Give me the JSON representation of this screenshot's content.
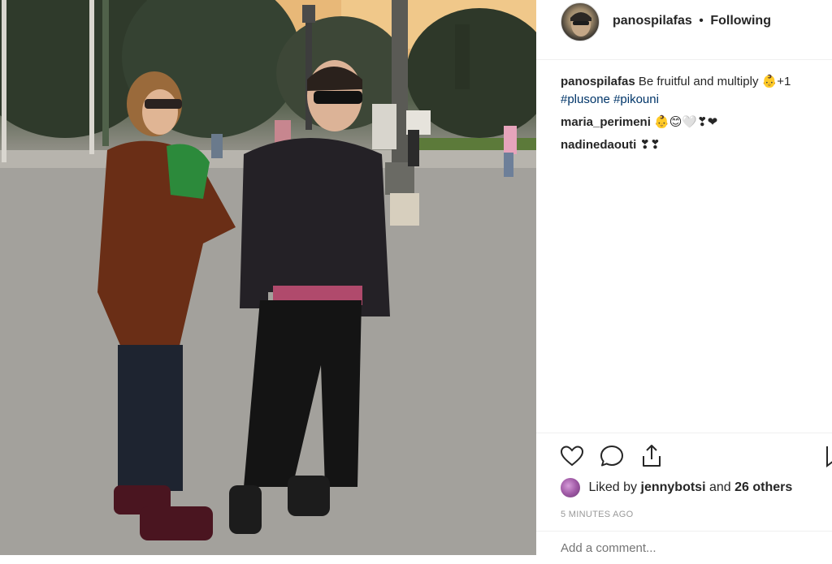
{
  "post": {
    "photo_icon": "photo-of-family-in-park",
    "header": {
      "username": "panospilafas",
      "separator": "•",
      "follow_state": "Following"
    },
    "comments": [
      {
        "user": "panospilafas",
        "text": "Be fruitful and multiply 👶+1",
        "hashtags": [
          "#plusone",
          "#pikouni"
        ]
      },
      {
        "user": "maria_perimeni",
        "text": "👶😊🤍❣❤"
      },
      {
        "user": "nadinedaouti",
        "text": "❣❣"
      }
    ],
    "actions": {
      "like_icon": "heart-icon",
      "comment_icon": "comment-bubble-icon",
      "share_icon": "share-icon",
      "save_icon": "bookmark-icon"
    },
    "likes": {
      "prefix": "Liked by",
      "user": "jennybotsi",
      "conjunction": "and",
      "others": "26 others"
    },
    "timestamp": "5 MINUTES AGO",
    "add_comment_placeholder": "Add a comment..."
  },
  "colors": {
    "text": "#262626",
    "hashtag": "#003569",
    "muted": "#999999",
    "divider": "#efefef"
  }
}
